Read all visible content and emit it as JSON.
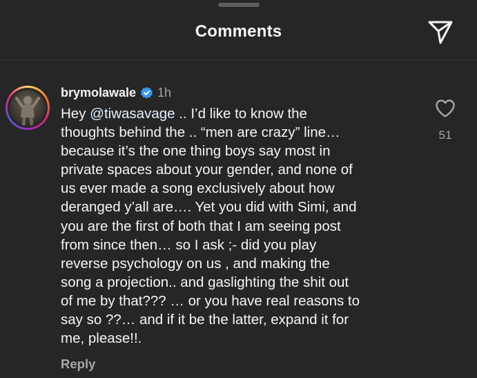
{
  "header": {
    "title": "Comments",
    "share_icon": "paper-plane-icon"
  },
  "comment": {
    "username": "brymolawale",
    "verified_icon": "verified-badge-icon",
    "verified_color": "#3897f0",
    "time": "1h",
    "mention": "@tiwasavage",
    "lines": [
      {
        "pre": "Hey ",
        "rest": " .. I’d like to know the"
      },
      "thoughts behind the .. “men are crazy”  line…",
      "because it’s the one thing boys say most in",
      "private spaces about your gender, and none of",
      "us ever made a song exclusively about how",
      "deranged y’all are…. Yet you did with Simi, and",
      "you are the first of both that I am seeing post",
      "from since then… so I ask ;- did you play",
      "reverse psychology on us , and making the",
      "song a projection.. and gaslighting the shit out",
      "of me by that??? … or you have real reasons to",
      "say so ??… and if it be the latter, expand it for",
      "me, please!!."
    ],
    "like_icon": "heart-outline-icon",
    "like_count": "51",
    "reply_label": "Reply"
  },
  "colors": {
    "background": "#262626",
    "text": "#f5f5f5",
    "secondary_text": "#a8a8a8",
    "mention": "#e0f1ff"
  }
}
